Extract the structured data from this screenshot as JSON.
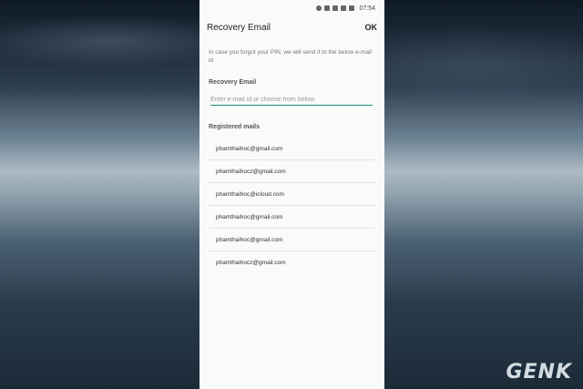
{
  "status_bar": {
    "time": "07:54"
  },
  "header": {
    "title": "Recovery Email",
    "ok_label": "OK"
  },
  "description": "In case you forgot your PIN, we will send it to the below e-mail id",
  "recovery_email": {
    "label": "Recovery Email",
    "value": "",
    "placeholder": "Enter e-mail id or choose from below"
  },
  "registered": {
    "label": "Registered mails",
    "mails": [
      "phamthaihoc@gmail.com",
      "phamthaihocz@gmail.com",
      "phamthaihoc@icloud.com",
      "phamthaihoc@gmail.com",
      "phamthaihoc@gmail.com",
      "phamthaihocz@gmail.com"
    ]
  },
  "watermark": "GENK",
  "colors": {
    "accent": "#1a8a7a",
    "background": "#fafafa"
  }
}
